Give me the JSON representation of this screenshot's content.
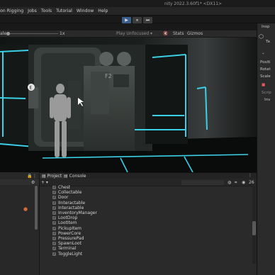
{
  "window": {
    "title": "nity 2022.3.60f1* <DX11>"
  },
  "menu": [
    "on Rigging",
    "Jobs",
    "Tools",
    "Tutorial",
    "Window",
    "Help"
  ],
  "play_controls": {
    "play": "▶",
    "pause": "⏸",
    "step": "⏭"
  },
  "game_view": {
    "scale_label": "ale",
    "scale_value": "1x",
    "play_mode": "Play Unfocused ▾",
    "stats": "Stats",
    "gizmos": "Gizmos"
  },
  "scene": {
    "prompt_key": "E",
    "door_sign": "F2"
  },
  "inspector": {
    "title": "Insp",
    "tag": "Ta",
    "transform_rows": [
      "Positi",
      "Rotat",
      "Scale"
    ],
    "script_label": "Scrip",
    "inv_label": "Inv"
  },
  "bottom_tabs": {
    "project": "Project",
    "console": "Console"
  },
  "project_toolbar": {
    "add": "+ ▾",
    "count": "26"
  },
  "project_files": [
    "Chest",
    "Collectable",
    "Door",
    "IInteractable",
    "Interactable",
    "InventoryManager",
    "LootDrop",
    "LootItem",
    "PickupItem",
    "PowerCore",
    "PressurePad",
    "SpawnLoot",
    "Terminal",
    "ToggleLight"
  ],
  "colors": {
    "accent": "#3a5e8c",
    "neon": "#3ad0e6"
  }
}
